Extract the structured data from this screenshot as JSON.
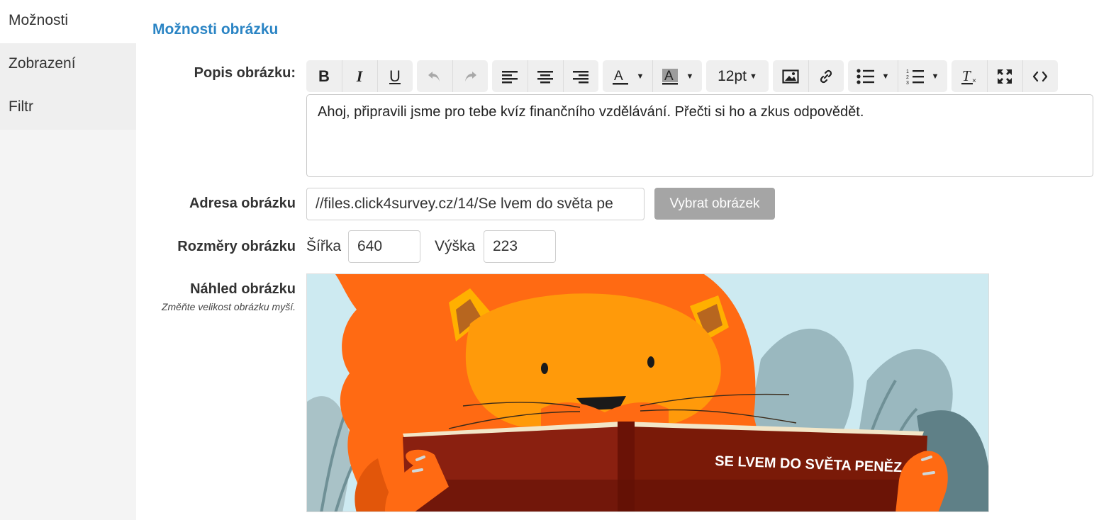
{
  "sidebar": {
    "items": [
      {
        "label": "Možnosti"
      },
      {
        "label": "Zobrazení"
      },
      {
        "label": "Filtr"
      }
    ]
  },
  "section": {
    "title": "Možnosti obrázku"
  },
  "description": {
    "label": "Popis obrázku:",
    "text": "Ahoj, připravili jsme pro tebe kvíz finančního vzdělávání. Přečti si ho a zkus odpovědět."
  },
  "toolbar": {
    "font_size": "12pt"
  },
  "image_url": {
    "label": "Adresa obrázku",
    "value": "//files.click4survey.cz/14/Se lvem do světa pe",
    "button_label": "Vybrat obrázek"
  },
  "dimensions": {
    "label": "Rozměry obrázku",
    "width_label": "Šířka",
    "width_value": "640",
    "height_label": "Výška",
    "height_value": "223"
  },
  "preview": {
    "label": "Náhled obrázku",
    "hint": "Změňte velikost obrázku myší.",
    "book_title": "SE LVEM DO SVĚTA PENĚZ"
  },
  "colors": {
    "accent": "#2a84c4",
    "lion_mane": "#ff6a13",
    "lion_face": "#ff9a0a",
    "book": "#7a1a08"
  }
}
